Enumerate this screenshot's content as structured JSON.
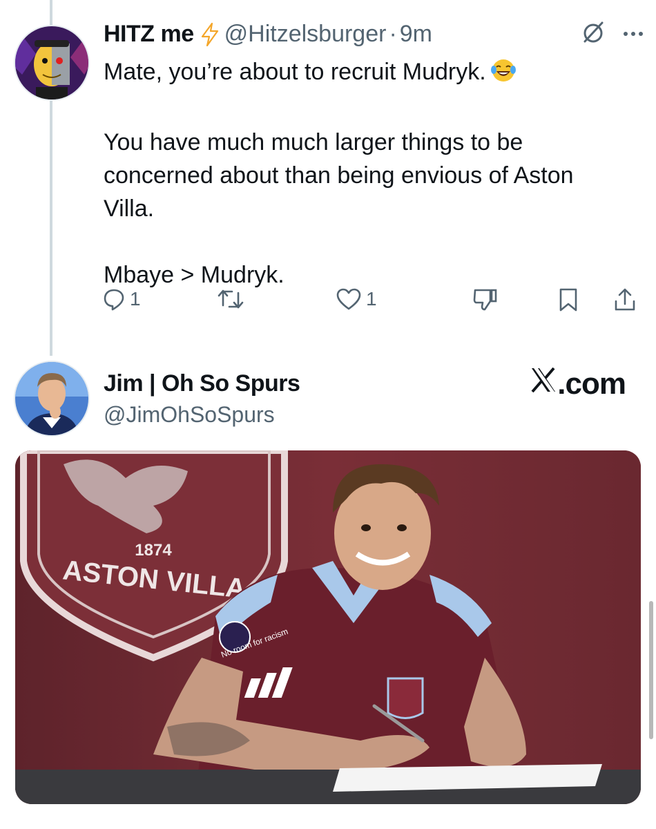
{
  "tweet1": {
    "display_name": "HITZ me",
    "handle": "@Hitzelsburger",
    "separator": "·",
    "time": "9m",
    "paragraphs": [
      "Mate, you’re about to recruit Mudryk.",
      "You have much much larger things to be concerned about than being envious of Aston Villa.",
      "Mbaye > Mudryk."
    ],
    "emoji": "laughing-tears-emoji",
    "actions": {
      "reply_count": "1",
      "like_count": "1"
    }
  },
  "tweet2": {
    "display_name": "Jim | Oh So Spurs",
    "handle": "@JimOhSoSpurs",
    "source_label": ".com",
    "photo": {
      "crest_year": "1874",
      "crest_text": "ASTON VILLA",
      "badge_text": "No room for racism"
    }
  },
  "colors": {
    "text": "#0f1419",
    "muted": "#536471",
    "thread_line": "#cfd9de",
    "claret": "#6e2a32",
    "bolt": "#f4a62a"
  },
  "icons": [
    "bolt-icon",
    "grok-icon",
    "more-icon",
    "reply-icon",
    "retweet-icon",
    "like-icon",
    "downvote-icon",
    "bookmark-icon",
    "share-icon",
    "x-logo"
  ]
}
